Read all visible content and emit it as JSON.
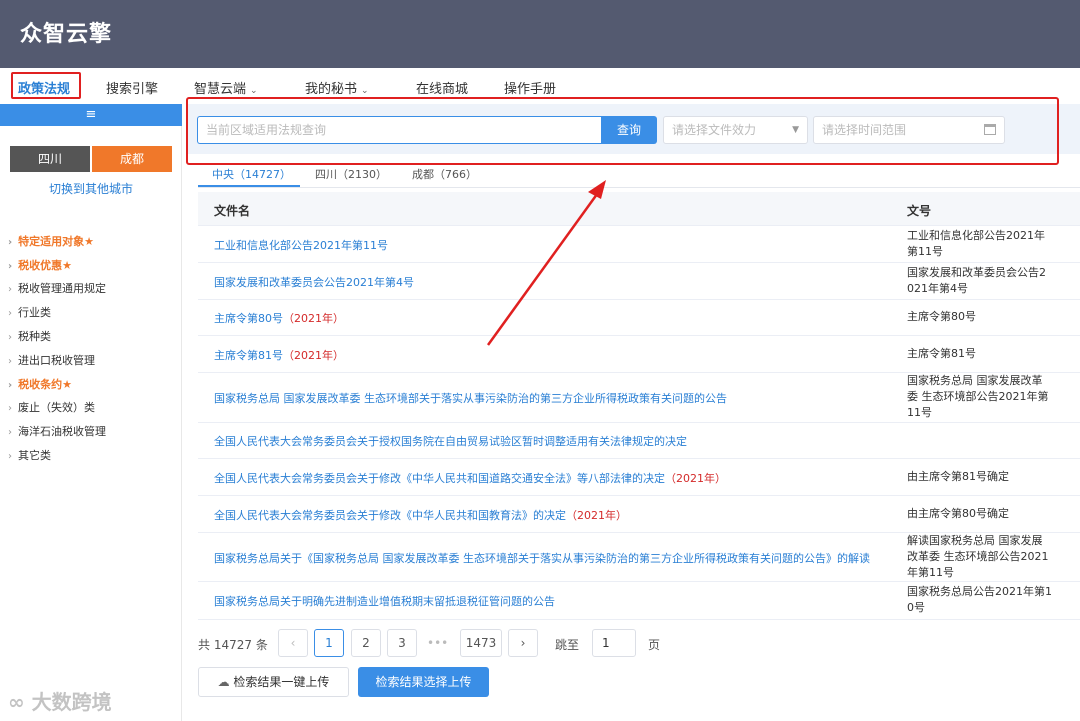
{
  "app": {
    "logo": "众智云擎"
  },
  "topnav": [
    {
      "label": "政策法规",
      "active": true,
      "has_menu": false
    },
    {
      "label": "搜索引擎",
      "active": false,
      "has_menu": false
    },
    {
      "label": "智慧云端",
      "active": false,
      "has_menu": true
    },
    {
      "label": "我的秘书",
      "active": false,
      "has_menu": true
    },
    {
      "label": "在线商城",
      "active": false,
      "has_menu": false
    },
    {
      "label": "操作手册",
      "active": false,
      "has_menu": false
    }
  ],
  "sidebar": {
    "menu_icon": "≡",
    "cities": [
      {
        "label": "四川",
        "active": false
      },
      {
        "label": "成都",
        "active": true
      }
    ],
    "switch_link": "切换到其他城市",
    "items": [
      {
        "label": "特定适用对象",
        "highlight": true
      },
      {
        "label": "税收优惠",
        "highlight": true
      },
      {
        "label": "税收管理通用规定",
        "highlight": false
      },
      {
        "label": "行业类",
        "highlight": false
      },
      {
        "label": "税种类",
        "highlight": false
      },
      {
        "label": "进出口税收管理",
        "highlight": false
      },
      {
        "label": "税收条约",
        "highlight": true
      },
      {
        "label": "废止（失效）类",
        "highlight": false
      },
      {
        "label": "海洋石油税收管理",
        "highlight": false
      },
      {
        "label": "其它类",
        "highlight": false
      }
    ],
    "star": "★"
  },
  "search": {
    "placeholder": "当前区域适用法规查询",
    "button": "查询",
    "effect_placeholder": "请选择文件效力",
    "date_placeholder": "请选择时间范围"
  },
  "tabs": [
    {
      "label": "中央（14727）",
      "active": true
    },
    {
      "label": "四川（2130）",
      "active": false
    },
    {
      "label": "成都（766）",
      "active": false
    }
  ],
  "table": {
    "headers": {
      "name": "文件名",
      "number": "文号"
    },
    "rows": [
      {
        "name": "工业和信息化部公告2021年第11号",
        "year": "",
        "number": "工业和信息化部公告2021年\n第11号"
      },
      {
        "name": "国家发展和改革委员会公告2021年第4号",
        "year": "",
        "number": "国家发展和改革委员会公告2\n021年第4号"
      },
      {
        "name": "主席令第80号",
        "year": "（2021年）",
        "number": "主席令第80号"
      },
      {
        "name": "主席令第81号",
        "year": "（2021年）",
        "number": "主席令第81号"
      },
      {
        "name": "国家税务总局 国家发展改革委 生态环境部关于落实从事污染防治的第三方企业所得税政策有关问题的公告",
        "year": "",
        "number": "国家税务总局 国家发展改革\n委 生态环境部公告2021年第\n11号"
      },
      {
        "name": "全国人民代表大会常务委员会关于授权国务院在自由贸易试验区暂时调整适用有关法律规定的决定",
        "year": "",
        "number": ""
      },
      {
        "name": "全国人民代表大会常务委员会关于修改《中华人民共和国道路交通安全法》等八部法律的决定",
        "year": "（2021年）",
        "number": "由主席令第81号确定"
      },
      {
        "name": "全国人民代表大会常务委员会关于修改《中华人民共和国教育法》的决定",
        "year": "（2021年）",
        "number": "由主席令第80号确定"
      },
      {
        "name": "国家税务总局关于《国家税务总局 国家发展改革委 生态环境部关于落实从事污染防治的第三方企业所得税政策有关问题的公告》的解读",
        "year": "",
        "number": "解读国家税务总局 国家发展\n改革委 生态环境部公告2021\n年第11号"
      },
      {
        "name": "国家税务总局关于明确先进制造业增值税期末留抵退税征管问题的公告",
        "year": "",
        "number": "国家税务总局公告2021年第1\n0号"
      }
    ]
  },
  "pagination": {
    "total_prefix": "共",
    "total": "14727",
    "total_suffix": "条",
    "prev": "‹",
    "pages": [
      "1",
      "2",
      "3"
    ],
    "dots": "•••",
    "last": "1473",
    "next": "›",
    "jump_label": "跳至",
    "jump_value": "1",
    "page_label": "页"
  },
  "actions": {
    "upload_all": "检索结果一键上传",
    "upload_selected": "检索结果选择上传"
  },
  "watermark": "大数跨境",
  "colors": {
    "header": "#545a70",
    "accent": "#3a8ee6",
    "highlight": "#f0782a",
    "annotation": "#e02020"
  }
}
